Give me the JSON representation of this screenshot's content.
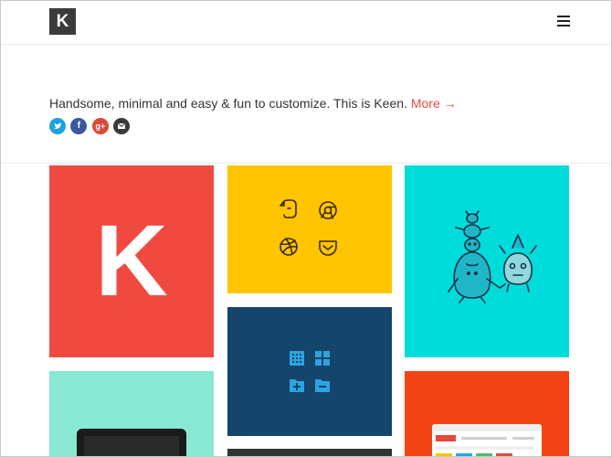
{
  "header": {
    "logo_letter": "K",
    "menu_icon": "hamburger-menu-icon"
  },
  "intro": {
    "tagline": "Handsome, minimal and easy & fun to customize. This is Keen.",
    "more_label": "More →",
    "social": [
      {
        "name": "twitter-icon",
        "glyph": "t",
        "color": "#1da1e0"
      },
      {
        "name": "facebook-icon",
        "glyph": "f",
        "color": "#3b5a9c"
      },
      {
        "name": "google-plus-icon",
        "glyph": "g+",
        "color": "#dc4a38"
      },
      {
        "name": "email-icon",
        "glyph": "✉",
        "color": "#3a3a3a"
      }
    ]
  },
  "tiles": {
    "k_tile": {
      "letter": "K",
      "color": "#f04a40"
    },
    "icons_tile": {
      "color": "#fec500",
      "icons": [
        "evernote-icon",
        "chrome-icon",
        "dribbble-icon",
        "pocket-icon"
      ]
    },
    "monsters_tile": {
      "color": "#00dcd9"
    },
    "folders_tile": {
      "color": "#14456b",
      "icons": [
        "grid-icon",
        "blocks-icon",
        "folder-add-icon",
        "folder-remove-icon"
      ]
    },
    "laptop_tile": {
      "color": "#88e8d3"
    },
    "browser_tile": {
      "color": "#f44416"
    }
  }
}
